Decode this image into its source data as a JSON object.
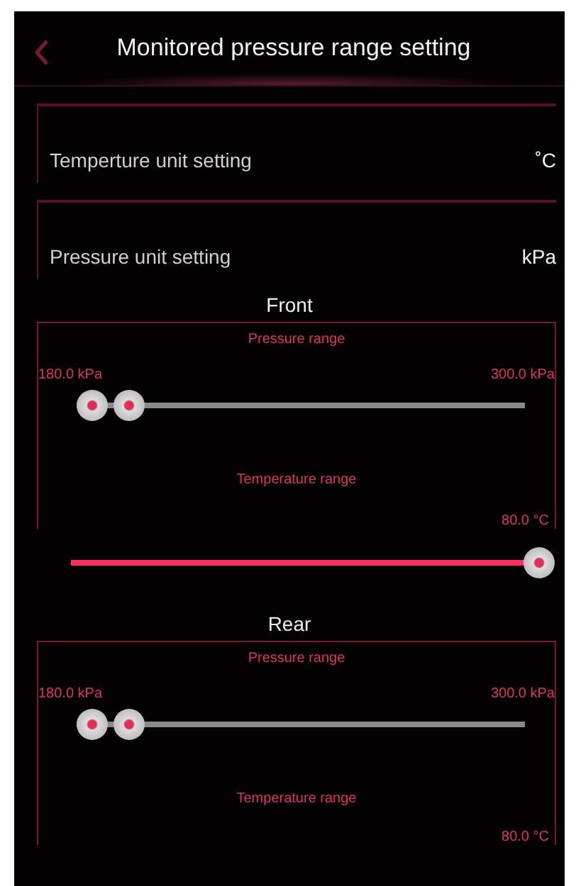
{
  "header": {
    "title": "Monitored pressure range setting"
  },
  "settings": [
    {
      "label": "Temperture unit setting",
      "value": "˚C"
    },
    {
      "label": "Pressure unit setting",
      "value": "kPa"
    }
  ],
  "sections": [
    {
      "title": "Front",
      "pressure": {
        "label": "Pressure range",
        "min_reading": "180.0 kPa",
        "max_reading": "300.0 kPa",
        "thumbs": [
          {
            "level": 0
          },
          {
            "level": 0.09
          }
        ]
      },
      "temperature": {
        "label": "Temperature range",
        "reading": "80.0 °C",
        "level": 1
      }
    },
    {
      "title": "Rear",
      "pressure": {
        "label": "Pressure range",
        "min_reading": "180.0 kPa",
        "max_reading": "300.0 kPa",
        "thumbs": [
          {
            "level": 0
          },
          {
            "level": 0.09
          }
        ]
      },
      "temperature": {
        "label": "Temperature range",
        "reading": "80.0 °C"
      }
    }
  ]
}
